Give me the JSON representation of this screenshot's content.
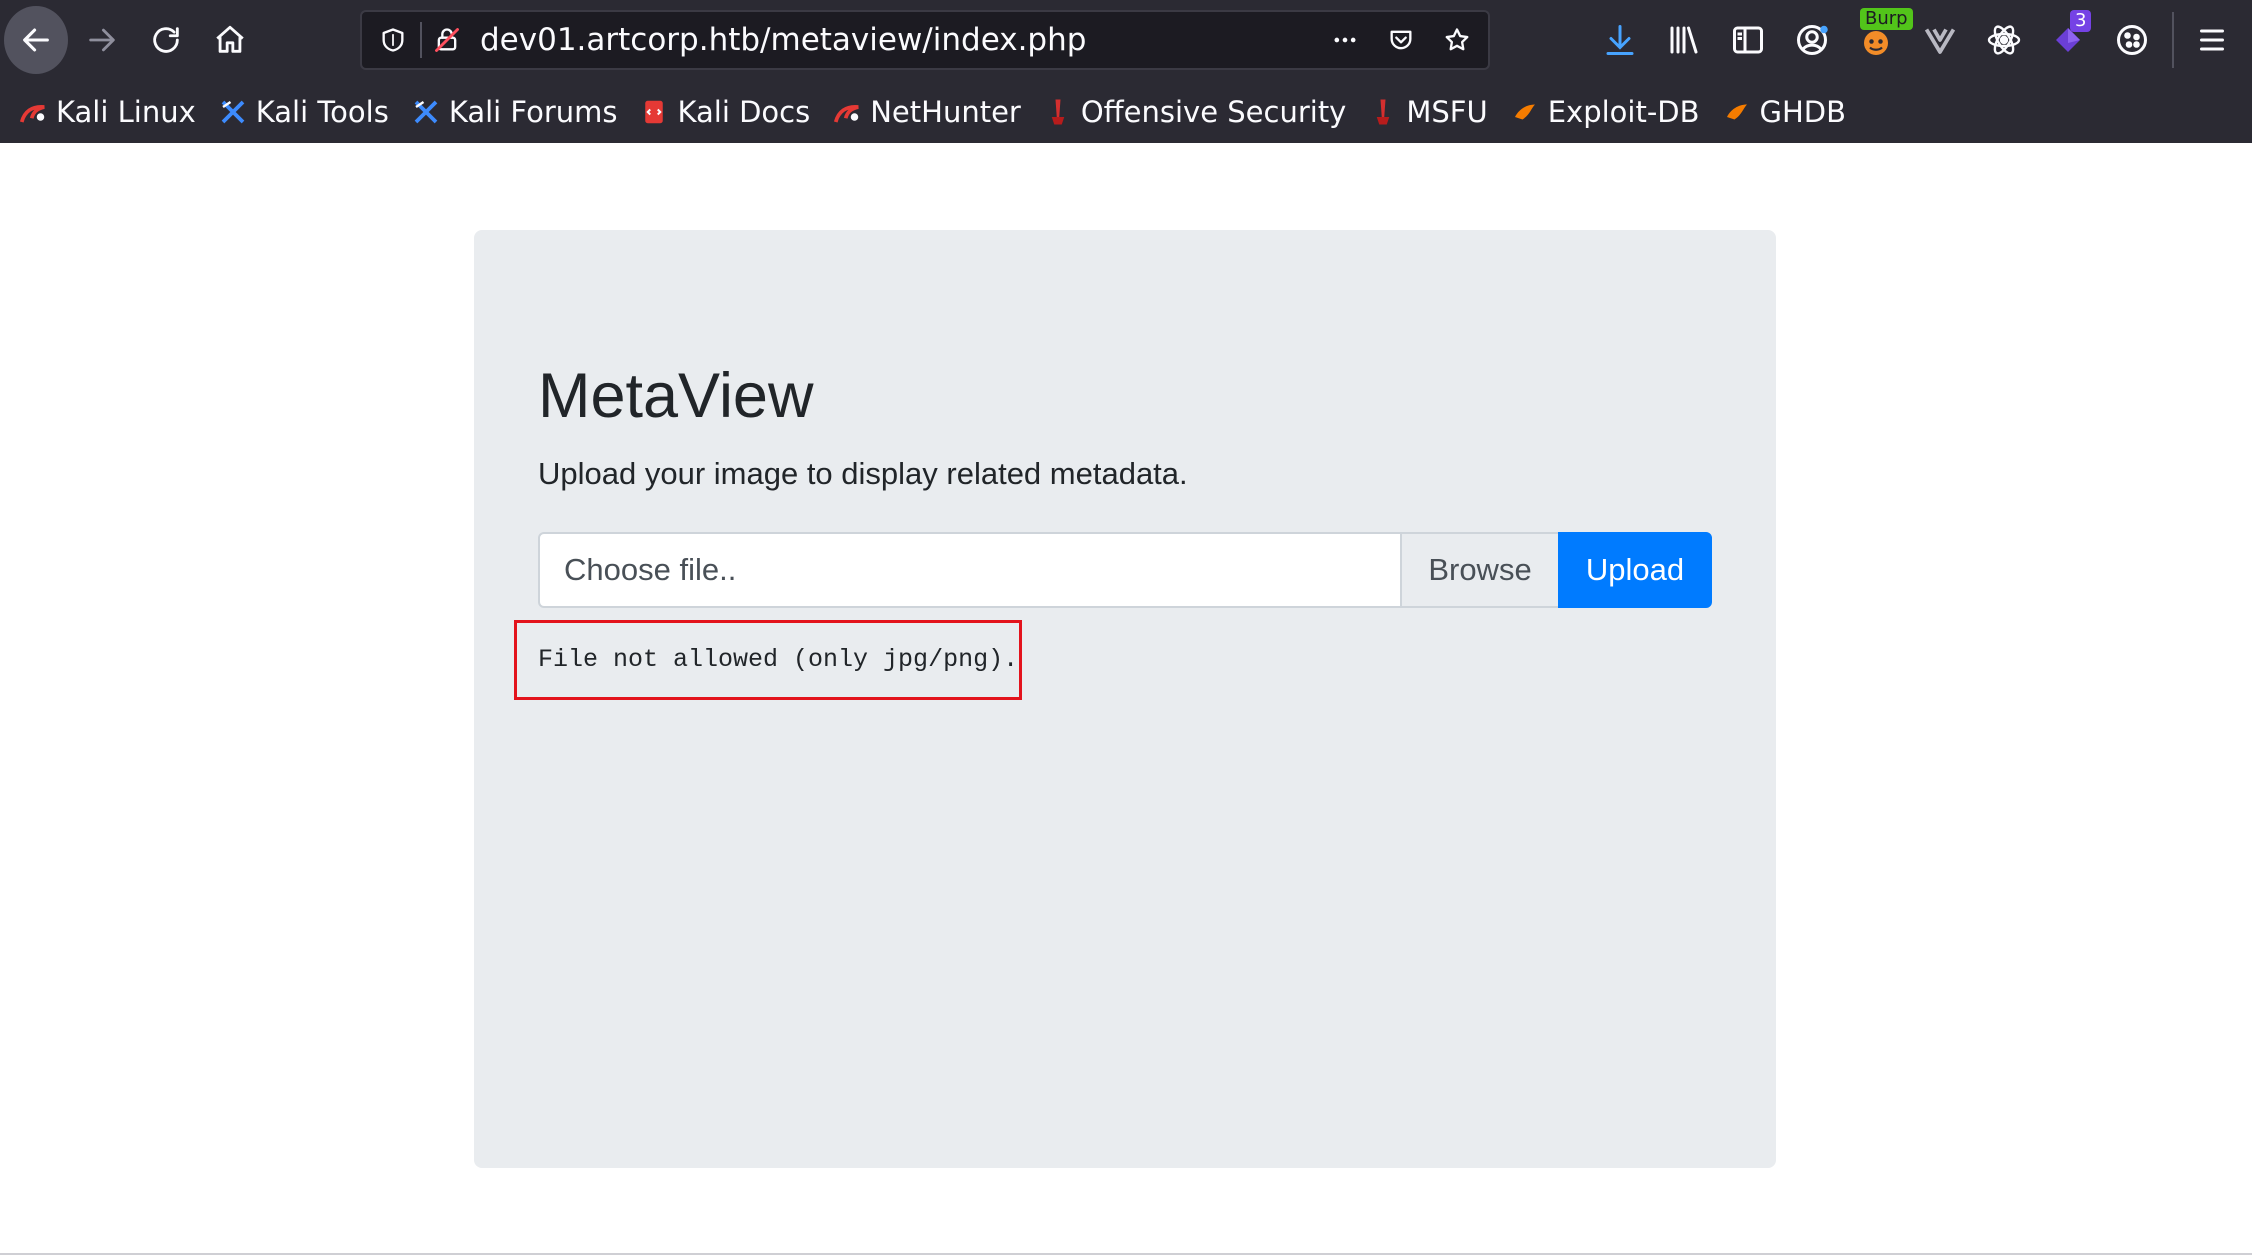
{
  "browser": {
    "url": "dev01.artcorp.htb/metaview/index.php",
    "icons": {
      "back": "arrow-left-icon",
      "forward": "arrow-right-icon",
      "reload": "reload-icon",
      "home": "home-icon",
      "shield": "shield-icon",
      "insecure": "insecure-lock-icon",
      "more": "more-dots-icon",
      "pocket": "pocket-icon",
      "bookmark_star": "star-icon"
    },
    "toolbar_icons": [
      "download-icon",
      "library-icon",
      "sidebar-icon",
      "account-icon",
      "burp-extension-icon",
      "vue-devtools-icon",
      "react-devtools-icon",
      "extension-icon",
      "cookie-icon",
      "menu-icon"
    ],
    "burp_badge": "Burp",
    "extension_badge": "3",
    "bookmarks": [
      {
        "label": "Kali Linux",
        "icon": "kali-icon"
      },
      {
        "label": "Kali Tools",
        "icon": "kali-tools-icon"
      },
      {
        "label": "Kali Forums",
        "icon": "kali-forums-icon"
      },
      {
        "label": "Kali Docs",
        "icon": "kali-docs-icon"
      },
      {
        "label": "NetHunter",
        "icon": "nethunter-icon"
      },
      {
        "label": "Offensive Security",
        "icon": "offsec-icon"
      },
      {
        "label": "MSFU",
        "icon": "msfu-icon"
      },
      {
        "label": "Exploit-DB",
        "icon": "exploitdb-icon"
      },
      {
        "label": "GHDB",
        "icon": "ghdb-icon"
      }
    ]
  },
  "page": {
    "title": "MetaView",
    "lead": "Upload your image to display related metadata.",
    "file_placeholder": "Choose file..",
    "browse_label": "Browse",
    "upload_label": "Upload",
    "error": "File not allowed (only jpg/png)."
  },
  "colors": {
    "chrome_bg": "#2b2a33",
    "jumbotron_bg": "#e9ecef",
    "primary": "#007bff",
    "error_border": "#e3131c"
  }
}
